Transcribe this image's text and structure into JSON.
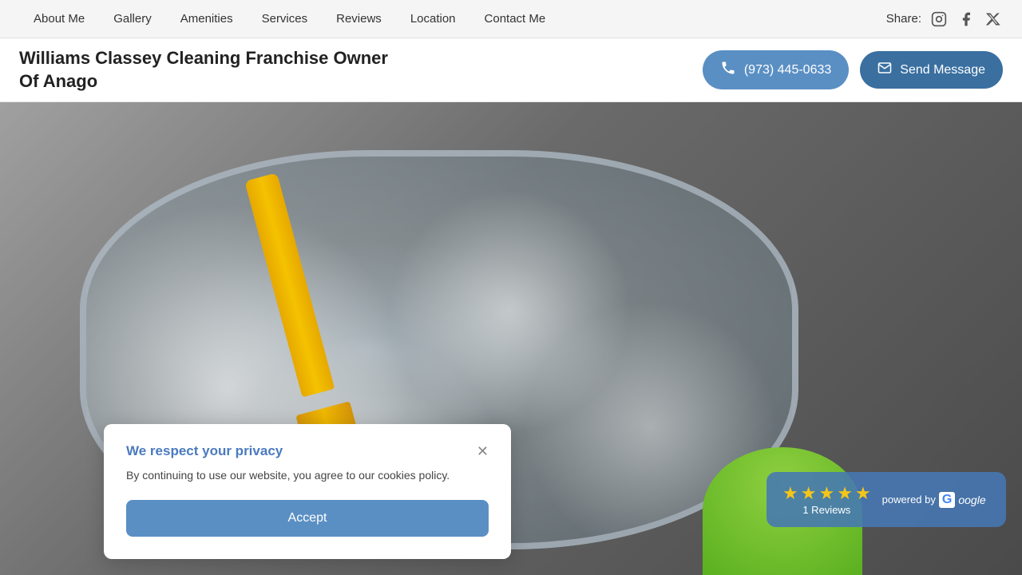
{
  "nav": {
    "links": [
      {
        "id": "about-me",
        "label": "About Me"
      },
      {
        "id": "gallery",
        "label": "Gallery"
      },
      {
        "id": "amenities",
        "label": "Amenities"
      },
      {
        "id": "services",
        "label": "Services"
      },
      {
        "id": "reviews",
        "label": "Reviews"
      },
      {
        "id": "location",
        "label": "Location"
      },
      {
        "id": "contact-me",
        "label": "Contact Me"
      }
    ],
    "share_label": "Share:",
    "social": [
      {
        "id": "instagram",
        "symbol": "@"
      },
      {
        "id": "facebook",
        "symbol": "f"
      },
      {
        "id": "twitter",
        "symbol": "✕"
      }
    ]
  },
  "header": {
    "title_line1": "Williams Classey Cleaning Franchise Owner",
    "title_line2": "Of Anago",
    "phone": "(973) 445-0633",
    "send_message": "Send Message"
  },
  "reviews": {
    "stars": 5,
    "count": "1 Reviews",
    "powered_by": "powered by",
    "google": "oogle"
  },
  "privacy": {
    "title": "We respect your privacy",
    "body": "By continuing to use our website, you agree to our cookies policy.",
    "accept": "Accept",
    "close_aria": "Close"
  }
}
